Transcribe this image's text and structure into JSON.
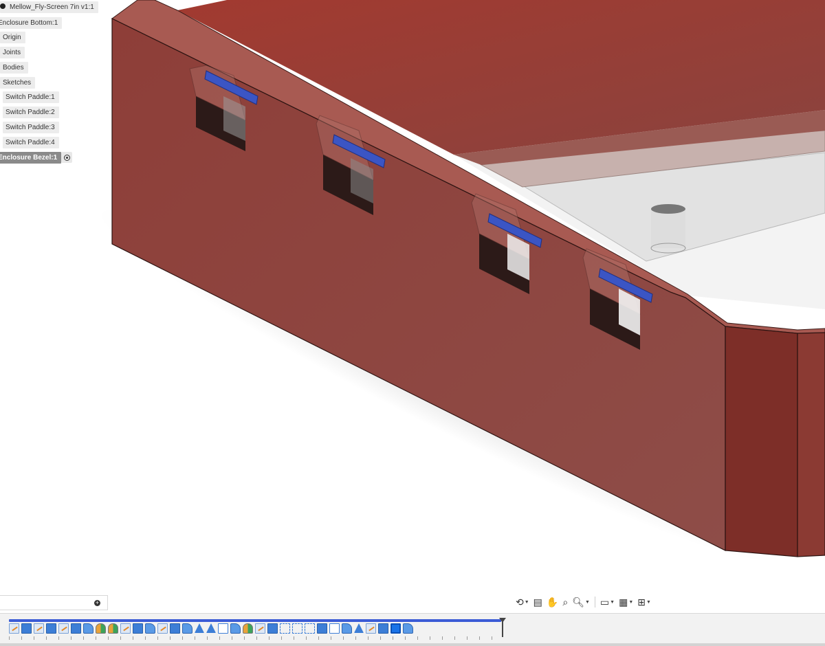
{
  "browser": {
    "root": "Mellow_Fly-Screen 7in v1:1",
    "component_bottom": "Enclosure Bottom:1",
    "origin": "Origin",
    "joints": "Joints",
    "bodies": "Bodies",
    "sketches": "Sketches",
    "paddles": [
      "Switch Paddle:1",
      "Switch Paddle:2",
      "Switch Paddle:3",
      "Switch Paddle:4"
    ],
    "component_bezel": "Enclosure Bezel:1"
  },
  "comments": {
    "add_icon": "plus-icon"
  },
  "nav_toolbar": {
    "icons": [
      "orbit-icon",
      "look-at-icon",
      "pan-icon",
      "zoom-window-icon",
      "zoom-icon",
      "display-settings-icon",
      "grid-icon",
      "viewports-icon"
    ]
  },
  "timeline": {
    "features": [
      "sketch",
      "extrude",
      "sketch",
      "extrude",
      "sketch",
      "extrude",
      "fillet",
      "mirror",
      "mirror",
      "sketch",
      "extrude",
      "fillet",
      "sketch",
      "extrude",
      "fillet",
      "draft",
      "draft",
      "combine",
      "fillet",
      "mirror",
      "sketch",
      "extrude",
      "move",
      "move",
      "move",
      "extrude",
      "combine",
      "fillet",
      "draft",
      "sketch",
      "extrude",
      "active",
      "fillet"
    ]
  },
  "colors": {
    "body": "#8f3a33",
    "paddle": "#3b55c4",
    "timeline_track": "#3b5bd6"
  }
}
